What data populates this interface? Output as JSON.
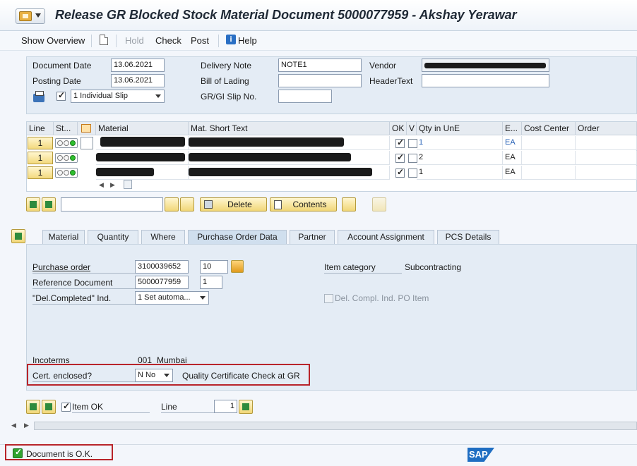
{
  "window": {
    "title": "Release GR Blocked Stock Material Document 5000077959 - Akshay Yerawar"
  },
  "toolbar": {
    "show_overview": "Show Overview",
    "hold": "Hold",
    "check": "Check",
    "post": "Post",
    "help": "Help"
  },
  "header": {
    "document_date_label": "Document Date",
    "document_date": "13.06.2021",
    "posting_date_label": "Posting Date",
    "posting_date": "13.06.2021",
    "slip_option": "1 Individual Slip",
    "delivery_note_label": "Delivery Note",
    "delivery_note": "NOTE1",
    "bill_of_lading_label": "Bill of Lading",
    "bill_of_lading": "",
    "grgi_slip_label": "GR/GI Slip No.",
    "grgi_slip": "",
    "vendor_label": "Vendor",
    "header_text_label": "HeaderText",
    "header_text": ""
  },
  "grid": {
    "columns": [
      "Line",
      "St...",
      "Material",
      "Mat. Short Text",
      "OK",
      "V",
      "Qty in UnE",
      "E...",
      "Cost Center",
      "Order"
    ],
    "rows": [
      {
        "line": "1",
        "qty": "1",
        "unit": "EA"
      },
      {
        "line": "1",
        "qty": "2",
        "unit": "EA"
      },
      {
        "line": "1",
        "qty": "1",
        "unit": "EA"
      }
    ]
  },
  "actions": {
    "delete": "Delete",
    "contents": "Contents",
    "find_value": ""
  },
  "tabs": [
    {
      "label": "Material"
    },
    {
      "label": "Quantity"
    },
    {
      "label": "Where"
    },
    {
      "label": "Purchase Order Data"
    },
    {
      "label": "Partner"
    },
    {
      "label": "Account Assignment"
    },
    {
      "label": "PCS Details"
    }
  ],
  "po_data": {
    "purchase_order_label": "Purchase order",
    "purchase_order": "3100039652",
    "po_item": "10",
    "reference_document_label": "Reference Document",
    "reference_document": "5000077959",
    "reference_item": "1",
    "del_completed_label": "\"Del.Completed\" Ind.",
    "del_completed": "1 Set automa...",
    "item_category_label": "Item category",
    "item_category": "Subcontracting",
    "del_compl_label": "Del. Compl. Ind. PO Item",
    "incoterms_label": "Incoterms",
    "incoterms_code": "001",
    "incoterms_place": "Mumbai",
    "cert_enclosed_label": "Cert. enclosed?",
    "cert_enclosed": "N No",
    "cert_desc": "Quality Certificate Check at GR"
  },
  "footer_row": {
    "item_ok_label": "Item OK",
    "line_label": "Line",
    "line_value": "1"
  },
  "status": {
    "message": "Document is O.K.",
    "logo": "SAP"
  }
}
